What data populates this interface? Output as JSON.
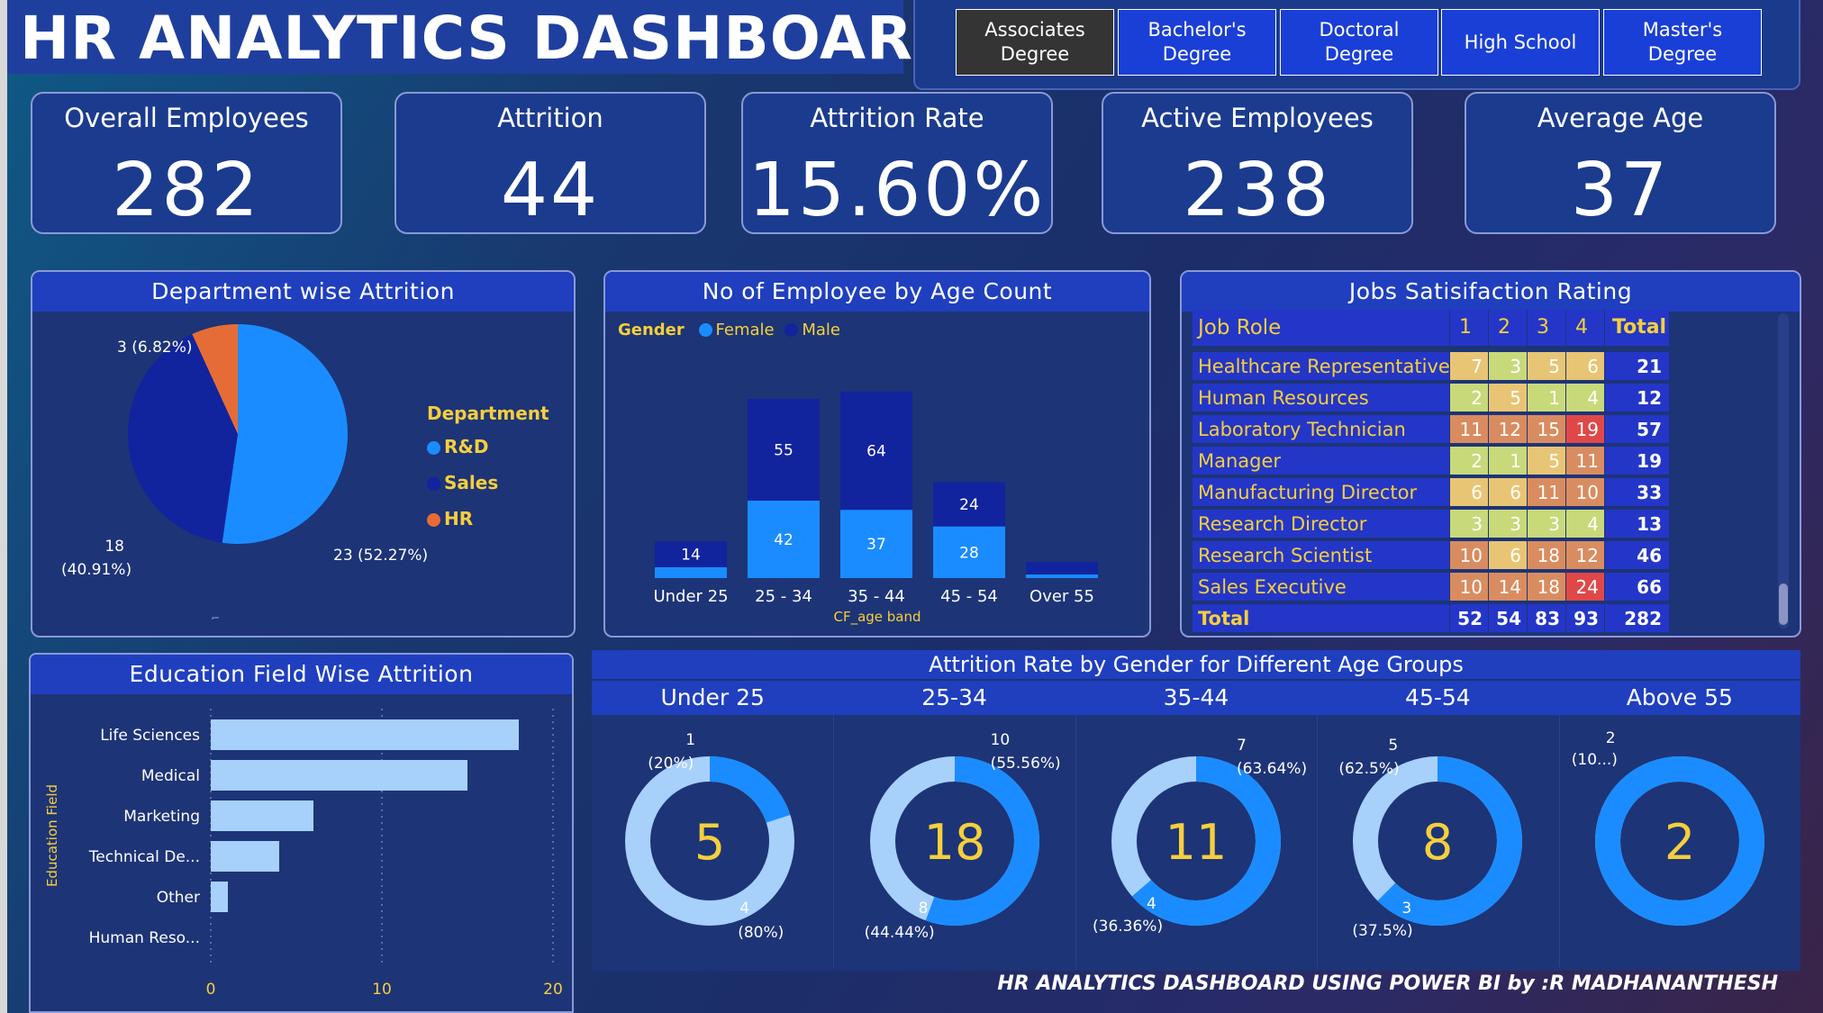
{
  "title": "HR ANALYTICS DASHBOARD",
  "slicer": {
    "options": [
      "Associates Degree",
      "Bachelor's Degree",
      "Doctoral Degree",
      "High School",
      "Master's Degree"
    ],
    "selected": "Associates Degree"
  },
  "kpis": [
    {
      "label": "Overall Employees",
      "value": "282"
    },
    {
      "label": "Attrition",
      "value": "44"
    },
    {
      "label": "Attrition Rate",
      "value": "15.60%"
    },
    {
      "label": "Active Employees",
      "value": "238"
    },
    {
      "label": "Average Age",
      "value": "37"
    }
  ],
  "department_chart": {
    "title": "Department wise Attrition",
    "legend_title": "Department",
    "labels": [
      "3 (6.82%)",
      "18 (40.91%)",
      "23 (52.27%)"
    ],
    "colors": {
      "R&D": "#1a8cff",
      "Sales": "#12239e",
      "HR": "#e66c37"
    }
  },
  "age_chart": {
    "title": "No of Employee by Age Count",
    "legend_title": "Gender",
    "legend": [
      "Female",
      "Male"
    ],
    "xlabel": "CF_age band"
  },
  "job_satisfaction": {
    "title": "Jobs Satisifaction Rating",
    "headers": [
      "Job Role",
      "1",
      "2",
      "3",
      "4",
      "Total"
    ],
    "rows": [
      {
        "role": "Healthcare Representative",
        "values": [
          "7",
          "3",
          "5",
          "6"
        ],
        "total": "21"
      },
      {
        "role": "Human Resources",
        "values": [
          "2",
          "5",
          "1",
          "4"
        ],
        "total": "12"
      },
      {
        "role": "Laboratory Technician",
        "values": [
          "11",
          "12",
          "15",
          "19"
        ],
        "total": "57"
      },
      {
        "role": "Manager",
        "values": [
          "2",
          "1",
          "5",
          "11"
        ],
        "total": "19"
      },
      {
        "role": "Manufacturing Director",
        "values": [
          "6",
          "6",
          "11",
          "10"
        ],
        "total": "33"
      },
      {
        "role": "Research Director",
        "values": [
          "3",
          "3",
          "3",
          "4"
        ],
        "total": "13"
      },
      {
        "role": "Research Scientist",
        "values": [
          "10",
          "6",
          "18",
          "12"
        ],
        "total": "46"
      },
      {
        "role": "Sales Executive",
        "values": [
          "10",
          "14",
          "18",
          "24"
        ],
        "total": "66"
      }
    ],
    "totals": {
      "role": "Total",
      "values": [
        "52",
        "54",
        "83",
        "93"
      ],
      "total": "282"
    }
  },
  "education_chart": {
    "title": "Education Field Wise Attrition",
    "ylabel": "Education Field"
  },
  "gender_age": {
    "title": "Attrition Rate by Gender for Different Age Groups",
    "groups": [
      {
        "name": "Under 25",
        "center": "5",
        "top_label": "1",
        "top_pct": "(20%)",
        "bottom_label": "4",
        "bottom_pct": "(80%)",
        "fraction": 0.2
      },
      {
        "name": "25-34",
        "center": "18",
        "top_label": "10",
        "top_pct": "(55.56%)",
        "bottom_label": "8",
        "bottom_pct": "(44.44%)",
        "fraction": 0.5556
      },
      {
        "name": "35-44",
        "center": "11",
        "top_label": "7",
        "top_pct": "(63.64%)",
        "bottom_label": "4",
        "bottom_pct": "(36.36%)",
        "fraction": 0.6364
      },
      {
        "name": "45-54",
        "center": "8",
        "top_label": "5",
        "top_pct": "(62.5%)",
        "bottom_label": "3",
        "bottom_pct": "(37.5%)",
        "fraction": 0.625
      },
      {
        "name": "Above 55",
        "center": "2",
        "top_label": "2",
        "top_pct": "(10...)",
        "bottom_label": "",
        "bottom_pct": "",
        "fraction": 1.0
      }
    ]
  },
  "footer": "HR ANALYTICS DASHBOARD USING POWER BI by :R MADHANANTHESH",
  "chart_data": [
    {
      "type": "pie",
      "title": "Department wise Attrition",
      "categories": [
        "R&D",
        "Sales",
        "HR"
      ],
      "values": [
        23,
        18,
        3
      ],
      "percentages": [
        52.27,
        40.91,
        6.82
      ],
      "legend": "right"
    },
    {
      "type": "bar",
      "title": "No of Employee by Age Count",
      "xlabel": "CF_age band",
      "categories": [
        "Under 25",
        "25 - 34",
        "35 - 44",
        "45 - 54",
        "Over 55"
      ],
      "series": [
        {
          "name": "Female",
          "values": [
            null,
            42,
            37,
            28,
            null
          ]
        },
        {
          "name": "Male",
          "values": [
            14,
            55,
            64,
            24,
            null
          ]
        }
      ],
      "stacked": true,
      "legend": "top-left"
    },
    {
      "type": "bar",
      "orientation": "horizontal",
      "title": "Education Field Wise Attrition",
      "ylabel": "Education Field",
      "categories": [
        "Life Sciences",
        "Medical",
        "Marketing",
        "Technical De...",
        "Other",
        "Human Reso..."
      ],
      "values": [
        18,
        15,
        6,
        4,
        1,
        0
      ],
      "xlim": [
        0,
        20
      ],
      "xticks": [
        "0",
        "10",
        "20"
      ],
      "grid": true
    },
    {
      "type": "pie",
      "title": "Attrition Rate by Gender for Different Age Groups",
      "categories": [
        "Under 25",
        "25-34",
        "35-44",
        "45-54",
        "Above 55"
      ],
      "series": [
        {
          "values": [
            1,
            10,
            7,
            5,
            2
          ]
        },
        {
          "values": [
            4,
            8,
            4,
            3,
            0
          ]
        }
      ],
      "totals": [
        5,
        18,
        11,
        8,
        2
      ]
    }
  ]
}
